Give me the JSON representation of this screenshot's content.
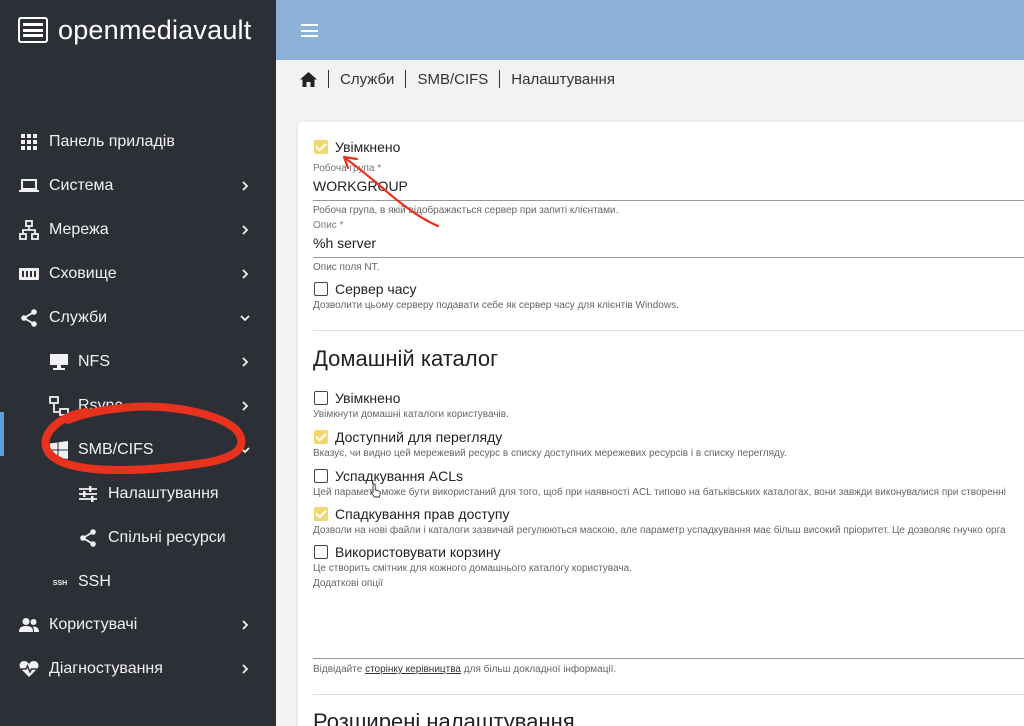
{
  "app": {
    "brand": "openmediavault"
  },
  "sidebar": {
    "items": [
      {
        "label": "Панель приладів",
        "icon": "grid-icon"
      },
      {
        "label": "Система",
        "icon": "laptop-icon"
      },
      {
        "label": "Мережа",
        "icon": "network-icon"
      },
      {
        "label": "Сховище",
        "icon": "storage-icon"
      },
      {
        "label": "Служби",
        "icon": "share-icon"
      },
      {
        "label": "NFS",
        "icon": "nfs-icon"
      },
      {
        "label": "Rsync",
        "icon": "rsync-icon"
      },
      {
        "label": "SMB/CIFS",
        "icon": "windows-icon"
      },
      {
        "label": "Налаштування",
        "icon": "sliders-icon"
      },
      {
        "label": "Спільні ресурси",
        "icon": "share-icon"
      },
      {
        "label": "SSH",
        "icon": "ssh-icon"
      },
      {
        "label": "Користувачі",
        "icon": "users-icon"
      },
      {
        "label": "Діагностування",
        "icon": "heartbeat-icon"
      }
    ]
  },
  "breadcrumb": {
    "items": [
      "Служби",
      "SMB/CIFS",
      "Налаштування"
    ]
  },
  "form": {
    "enabled": {
      "label": "Увімкнено",
      "checked": true
    },
    "workgroup": {
      "label": "Робоча група *",
      "value": "WORKGROUP",
      "hint": "Робоча група, в якій відображається сервер при запиті клієнтами."
    },
    "description": {
      "label": "Опис *",
      "value": "%h server",
      "hint": "Опис поля NT."
    },
    "time_server": {
      "label": "Сервер часу",
      "checked": false,
      "hint": "Дозволити цьому серверу подавати себе як сервер часу для клієнтів Windows."
    },
    "home_section": {
      "title": "Домашній каталог"
    },
    "home_enabled": {
      "label": "Увімкнено",
      "checked": false,
      "hint": "Увімкнути домашні каталоги користувачів."
    },
    "browseable": {
      "label": "Доступний для перегляду",
      "checked": true,
      "hint": "Вказує, чи видно цей мережевий ресурс в списку доступних мережевих ресурсів і в списку перегляду."
    },
    "inherit_acls": {
      "label": "Успадкування ACLs",
      "checked": false,
      "hint": "Цей параметр може бути використаний для того, щоб при наявності ACL типово на батьківських каталогах, вони завжди виконувалися при створенні"
    },
    "inherit_permissions": {
      "label": "Спадкування прав доступу",
      "checked": true,
      "hint": "Дозволи на нові файли і каталоги зазвичай регулюються маскою, але параметр успадкування має більш високий пріоритет. Це дозволяє гнучко орга"
    },
    "recycle_bin": {
      "label": "Використовувати корзину",
      "checked": false,
      "hint": "Це створить смітник для кожного домашнього каталогу користувача."
    },
    "extra_options": {
      "label": "Додаткові опції"
    },
    "manual_hint": {
      "prefix": "Відвідайте ",
      "link": "сторінку керівництва",
      "suffix": " для більш докладної інформації."
    },
    "advanced_section": {
      "title": "Розширені налаштування"
    }
  },
  "colors": {
    "sidebar_bg": "#2c3036",
    "topbar_bg": "#8db2d8",
    "checkbox_checked": "#f2d76e",
    "annotation": "#e8321e"
  }
}
